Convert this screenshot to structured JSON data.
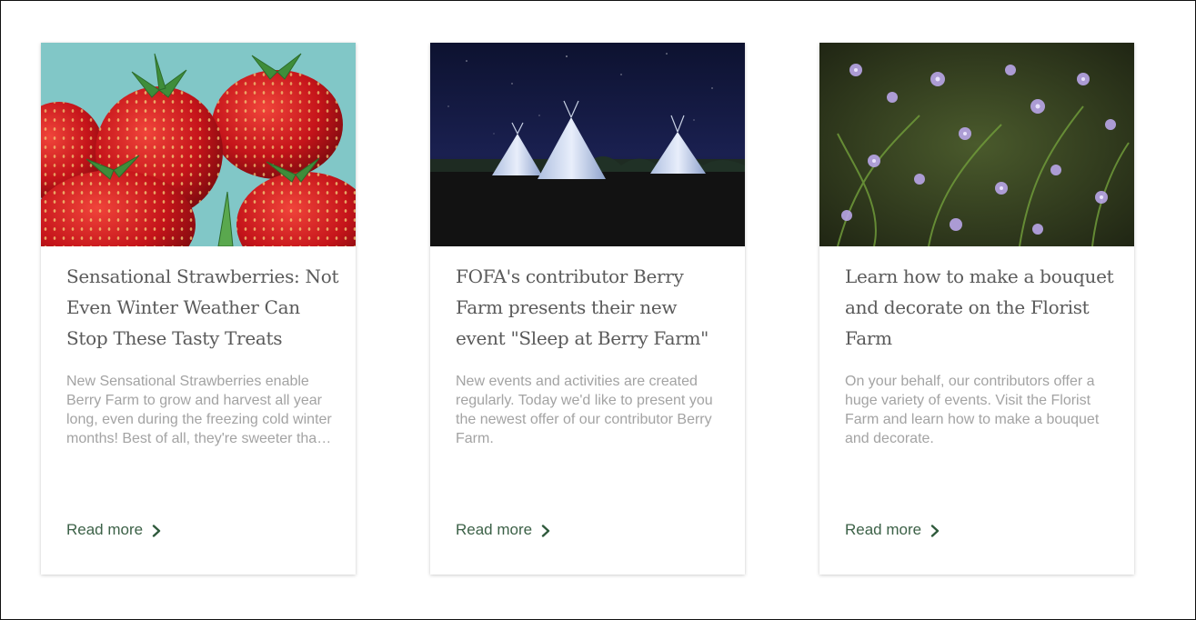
{
  "cards": [
    {
      "title": "Sensational Strawberries: Not Even Winter Weather Can Stop These Tasty Treats",
      "excerpt": "New Sensational Strawberries enable Berry Farm to grow and harvest all year long, even during the freezing cold winter months! Best of all, they're sweeter than ever.",
      "link_label": "Read more",
      "image": "strawberries-photo",
      "link_icon": "chevron-right-icon"
    },
    {
      "title": "FOFA's contributor Berry Farm presents their new event \"Sleep at Berry Farm\"",
      "excerpt": "New events and activities are created regularly. Today we'd like to present you the newest offer of our contributor Berry Farm.",
      "link_label": "Read more",
      "image": "teepees-at-night-photo",
      "link_icon": "chevron-right-icon"
    },
    {
      "title": "Learn how to make a bouquet and decorate on the Florist Farm",
      "excerpt": "On your behalf, our contributors offer a huge variety of events. Visit the Florist Farm and learn how to make a bouquet and decorate.",
      "link_label": "Read more",
      "image": "purple-flowers-photo",
      "link_icon": "chevron-right-icon"
    }
  ],
  "colors": {
    "title": "#5a5a5a",
    "excerpt": "#a3a3a3",
    "link": "#3c6147"
  }
}
